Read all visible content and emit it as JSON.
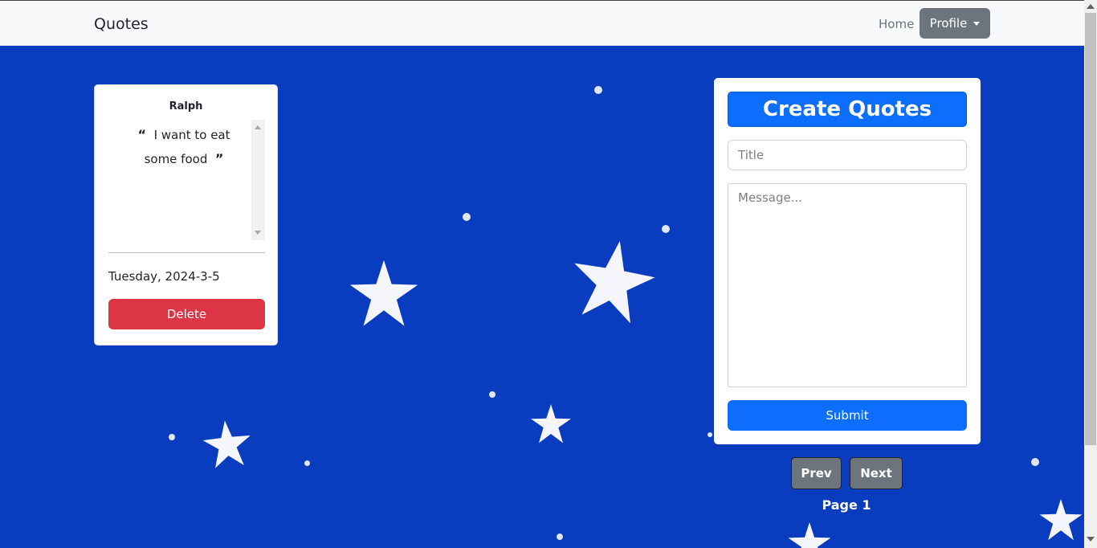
{
  "navbar": {
    "brand": "Quotes",
    "home_link": "Home",
    "profile_button": "Profile"
  },
  "quote_card": {
    "author": "Ralph",
    "open_quote": "“",
    "text": "I want to eat some food",
    "close_quote": "”",
    "date": "Tuesday, 2024-3-5",
    "delete_label": "Delete"
  },
  "create_form": {
    "header": "Create Quotes",
    "title_placeholder": "Title",
    "message_placeholder": "Message...",
    "submit_label": "Submit"
  },
  "pagination": {
    "prev_label": "Prev",
    "next_label": "Next",
    "page_label": "Page 1"
  },
  "colors": {
    "background": "#0a3cbf",
    "primary": "#0d6efd",
    "danger": "#dc3545",
    "secondary": "#6c757d"
  }
}
